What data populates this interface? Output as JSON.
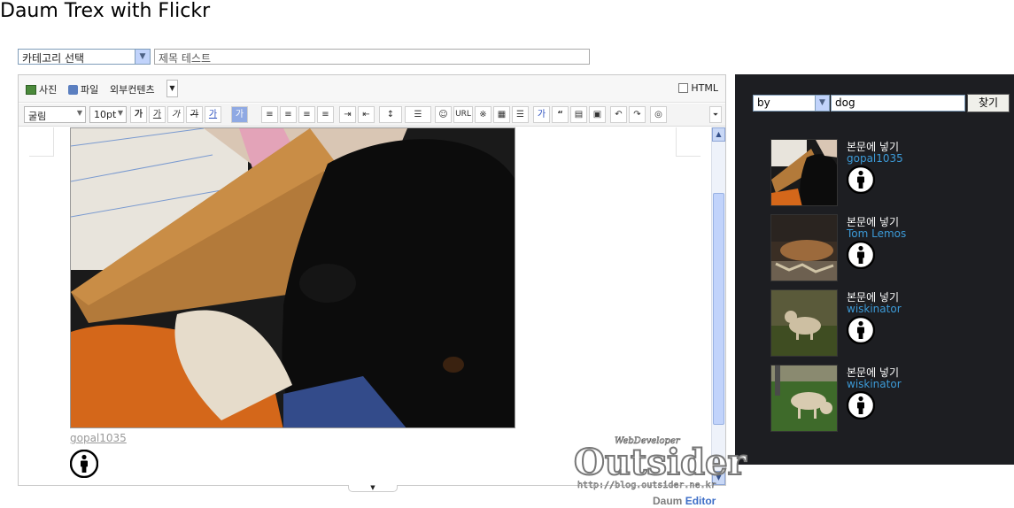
{
  "page": {
    "title": "Daum Trex with Flickr"
  },
  "form": {
    "category_select": "카테고리 선택",
    "title_input": "제목 테스트"
  },
  "toolbar1": {
    "photo_label": "사진",
    "file_label": "파일",
    "external_label": "외부컨텐츠",
    "html_label": "HTML"
  },
  "toolbar2": {
    "font_family": "굴림",
    "font_size": "10pt",
    "bold_glyph": "가",
    "underline_glyph": "가",
    "italic_glyph": "가",
    "strike_glyph": "가",
    "fontcolor_glyph": "가",
    "bgcolor_glyph": "가",
    "url_label": "URL",
    "special_char": "※",
    "quote_glyph": "“",
    "bg_glyph": "가"
  },
  "editor": {
    "photo_credit": "gopal1035"
  },
  "flickr": {
    "search_by": "by",
    "search_query": "dog",
    "search_button": "찾기",
    "results": [
      {
        "insert_label": "본문에 넣기",
        "author": "gopal1035"
      },
      {
        "insert_label": "본문에 넣기",
        "author": "Tom Lemos"
      },
      {
        "insert_label": "본문에 넣기",
        "author": "wiskinator"
      },
      {
        "insert_label": "본문에 넣기",
        "author": "wiskinator"
      }
    ]
  },
  "watermark": {
    "top_text": "WebDeveloper",
    "main_text": "Outsider",
    "url_text": "http://blog.outsider.ne.kr"
  },
  "footer": {
    "daum": "Daum",
    "editor": "Editor"
  }
}
